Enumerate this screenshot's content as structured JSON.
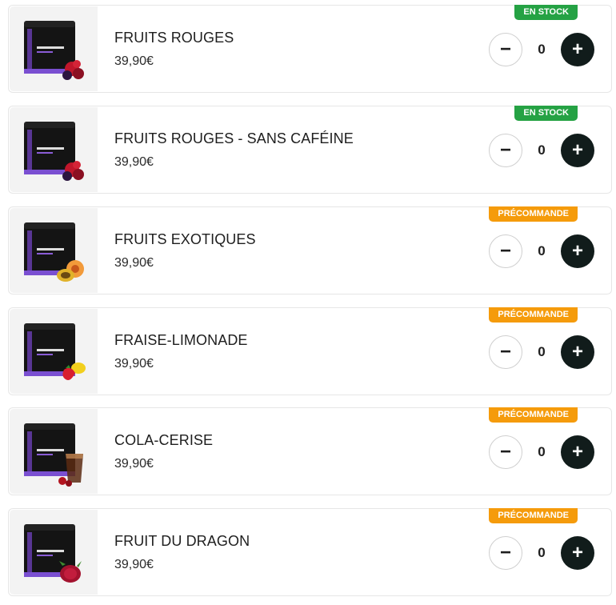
{
  "products": [
    {
      "name": "FRUITS ROUGES",
      "price": "39,90€",
      "badge": "EN STOCK",
      "badge_color": "#25a244",
      "quantity": "0",
      "fruit_icon": "red-berries-icon"
    },
    {
      "name": "FRUITS ROUGES - SANS CAFÉINE",
      "price": "39,90€",
      "badge": "EN STOCK",
      "badge_color": "#25a244",
      "quantity": "0",
      "fruit_icon": "red-berries-icon"
    },
    {
      "name": "FRUITS EXOTIQUES",
      "price": "39,90€",
      "badge": "PRÉCOMMANDE",
      "badge_color": "#f59b0b",
      "quantity": "0",
      "fruit_icon": "passion-fruit-peach-icon"
    },
    {
      "name": "FRAISE-LIMONADE",
      "price": "39,90€",
      "badge": "PRÉCOMMANDE",
      "badge_color": "#f59b0b",
      "quantity": "0",
      "fruit_icon": "strawberry-lemon-icon"
    },
    {
      "name": "COLA-CERISE",
      "price": "39,90€",
      "badge": "PRÉCOMMANDE",
      "badge_color": "#f59b0b",
      "quantity": "0",
      "fruit_icon": "cola-cherry-icon"
    },
    {
      "name": "FRUIT DU DRAGON",
      "price": "39,90€",
      "badge": "PRÉCOMMANDE",
      "badge_color": "#f59b0b",
      "quantity": "0",
      "fruit_icon": "dragon-fruit-icon"
    }
  ],
  "stepper": {
    "minus_label": "−",
    "plus_label": "+"
  },
  "colors": {
    "jar": "#141414",
    "accent": "#6a3fb5",
    "plus_button": "#111c1b"
  }
}
